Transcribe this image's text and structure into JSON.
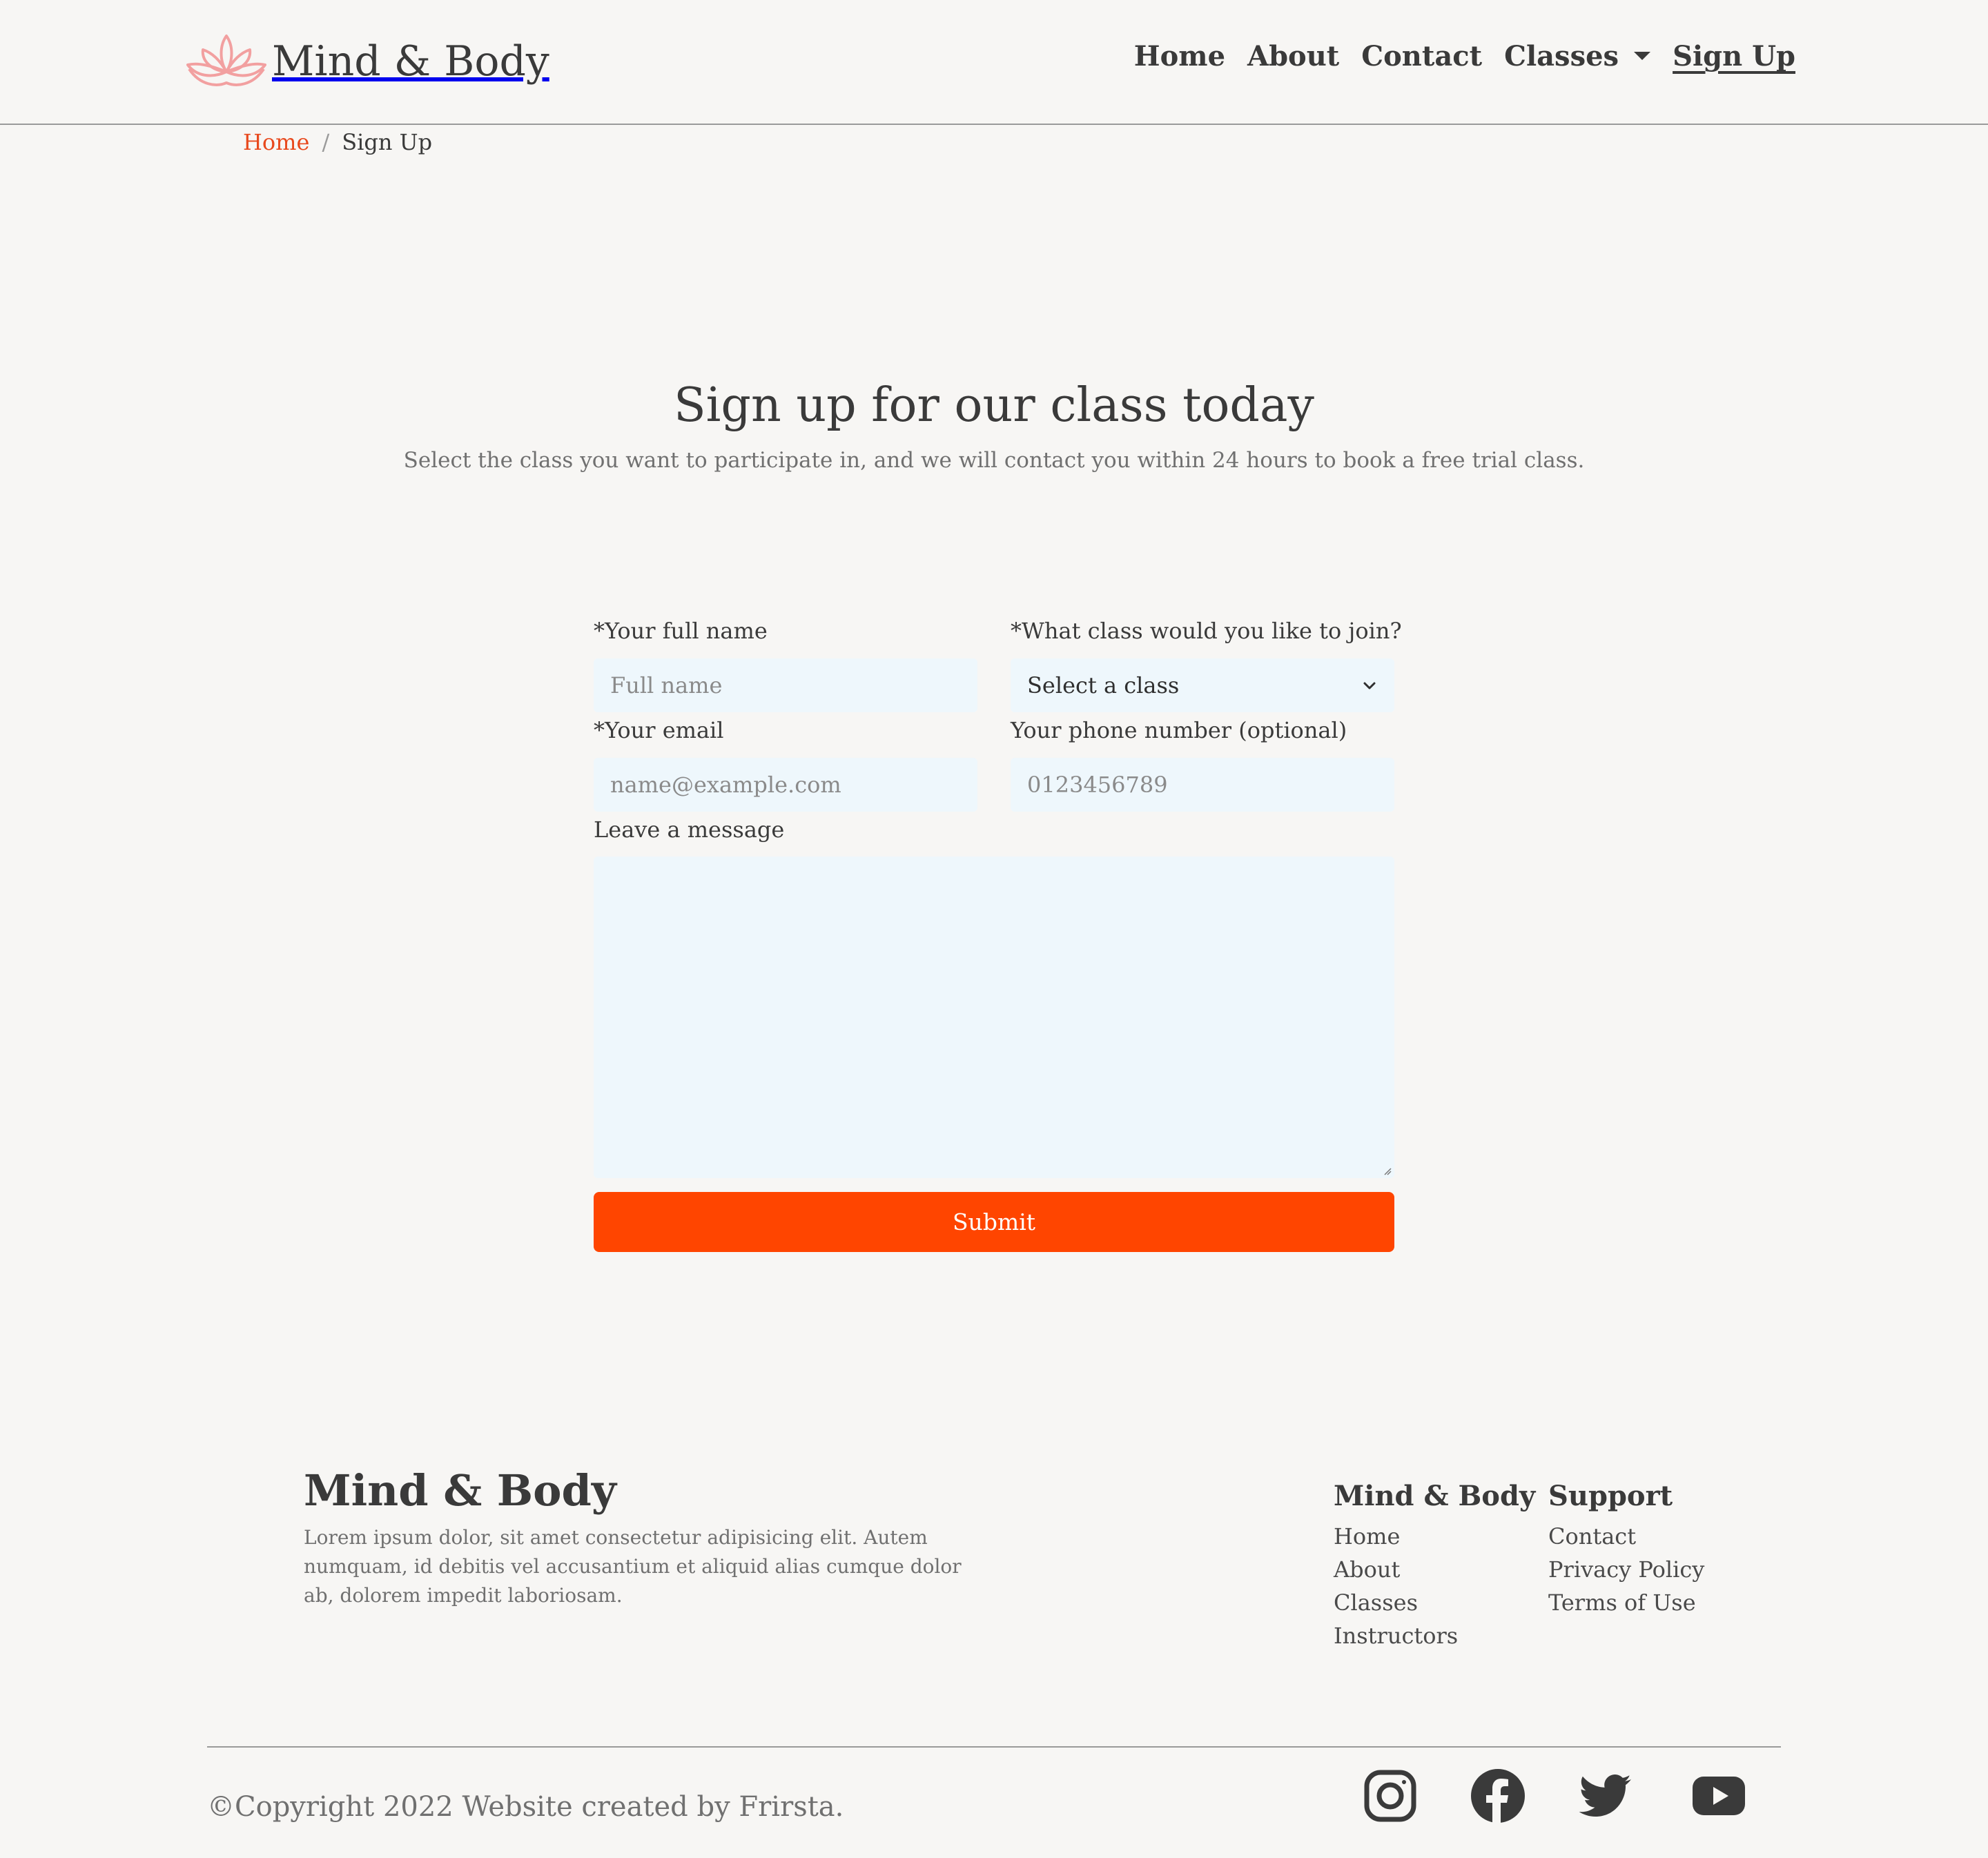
{
  "header": {
    "brand": "Mind & Body",
    "nav": {
      "home": "Home",
      "about": "About",
      "contact": "Contact",
      "classes": "Classes",
      "signup": "Sign Up"
    }
  },
  "breadcrumb": {
    "home": "Home",
    "separator": "/",
    "current": "Sign Up"
  },
  "hero": {
    "title": "Sign up for our class today",
    "subtitle": "Select the class you want to participate in, and we will contact you within 24 hours to book a free trial class."
  },
  "form": {
    "name_label": "*Your full name",
    "name_placeholder": "Full name",
    "class_label": "*What class would you like to join?",
    "class_selected": "Select a class",
    "email_label": "*Your email",
    "email_placeholder": "name@example.com",
    "phone_label": "Your phone number (optional)",
    "phone_placeholder": "0123456789",
    "message_label": "Leave a message",
    "submit_label": "Submit"
  },
  "footer": {
    "brand": "Mind & Body",
    "description": "Lorem ipsum dolor, sit amet consectetur adipisicing elit. Autem numquam, id debitis vel accusantium et aliquid alias cumque dolor ab, dolorem impedit laboriosam.",
    "col1": {
      "title": "Mind & Body",
      "links": [
        "Home",
        "About",
        "Classes",
        "Instructors"
      ]
    },
    "col2": {
      "title": "Support",
      "links": [
        "Contact",
        "Privacy Policy",
        "Terms of Use"
      ]
    },
    "copyright": "©Copyright 2022 Website created by Frirsta.",
    "social_icons": [
      "instagram-icon",
      "facebook-icon",
      "twitter-icon",
      "youtube-icon"
    ]
  },
  "colors": {
    "accent": "#ff4500",
    "breadcrumb_link": "#e8491d",
    "logo": "#f2a0a0",
    "field_bg": "#eef7fc",
    "page_bg": "#f7f6f4"
  }
}
